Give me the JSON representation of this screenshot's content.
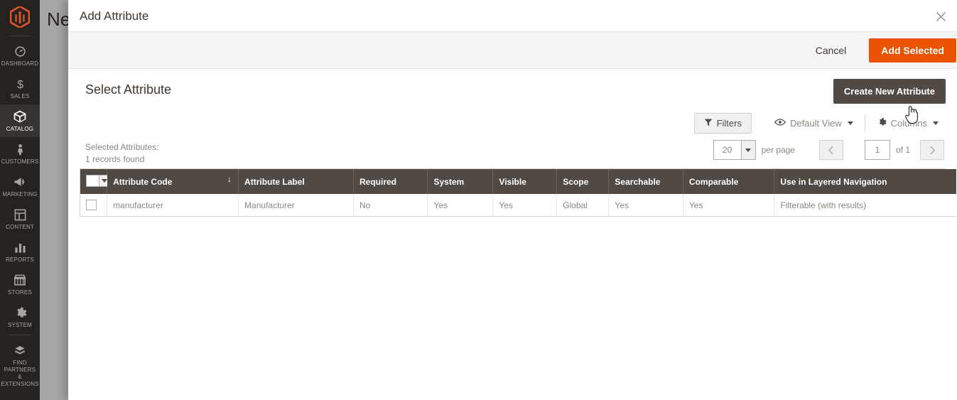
{
  "sidebar": {
    "logo_name": "magento-logo",
    "items": [
      {
        "label": "DASHBOARD",
        "icon": "dashboard-icon",
        "active": false
      },
      {
        "label": "SALES",
        "icon": "dollar-icon",
        "active": false
      },
      {
        "label": "CATALOG",
        "icon": "box-icon",
        "active": true
      },
      {
        "label": "CUSTOMERS",
        "icon": "person-icon",
        "active": false
      },
      {
        "label": "MARKETING",
        "icon": "megaphone-icon",
        "active": false
      },
      {
        "label": "CONTENT",
        "icon": "layout-icon",
        "active": false
      },
      {
        "label": "REPORTS",
        "icon": "bar-chart-icon",
        "active": false
      },
      {
        "label": "STORES",
        "icon": "store-icon",
        "active": false
      },
      {
        "label": "SYSTEM",
        "icon": "gear-icon",
        "active": false
      },
      {
        "label": "FIND PARTNERS\n& EXTENSIONS",
        "icon": "extension-icon",
        "active": false
      }
    ]
  },
  "page_behind": {
    "title": "New"
  },
  "modal": {
    "title": "Add Attribute",
    "close_icon": "close-icon",
    "cancel_label": "Cancel",
    "add_selected_label": "Add Selected"
  },
  "section": {
    "title": "Select Attribute",
    "create_new_label": "Create New Attribute"
  },
  "toolbar": {
    "filters_label": "Filters",
    "filters_icon": "funnel-icon",
    "view_label": "Default View",
    "view_icon": "eye-icon",
    "columns_label": "Columns",
    "columns_icon": "gear-icon"
  },
  "grid_meta": {
    "selected_label": "Selected Attributes:",
    "records_found": "1 records found",
    "per_page_value": "20",
    "per_page_label": "per page",
    "page_value": "1",
    "of_pages": "of 1",
    "prev_icon": "chevron-left-icon",
    "next_icon": "chevron-right-icon"
  },
  "table": {
    "columns": [
      "Attribute Code",
      "Attribute Label",
      "Required",
      "System",
      "Visible",
      "Scope",
      "Searchable",
      "Comparable",
      "Use in Layered Navigation"
    ],
    "sorted_column": "Attribute Code",
    "sort_arrow": "↓",
    "rows": [
      {
        "attribute_code": "manufacturer",
        "attribute_label": "Manufacturer",
        "required": "No",
        "system": "Yes",
        "visible": "Yes",
        "scope": "Global",
        "searchable": "Yes",
        "comparable": "Yes",
        "layered_navigation": "Filterable (with results)"
      }
    ]
  },
  "colors": {
    "brand_orange": "#eb5202",
    "sidebar_bg": "#252220",
    "header_row": "#514943",
    "muted_text": "#8c867f"
  },
  "cursor": {
    "type": "pointer-hand-cursor"
  }
}
